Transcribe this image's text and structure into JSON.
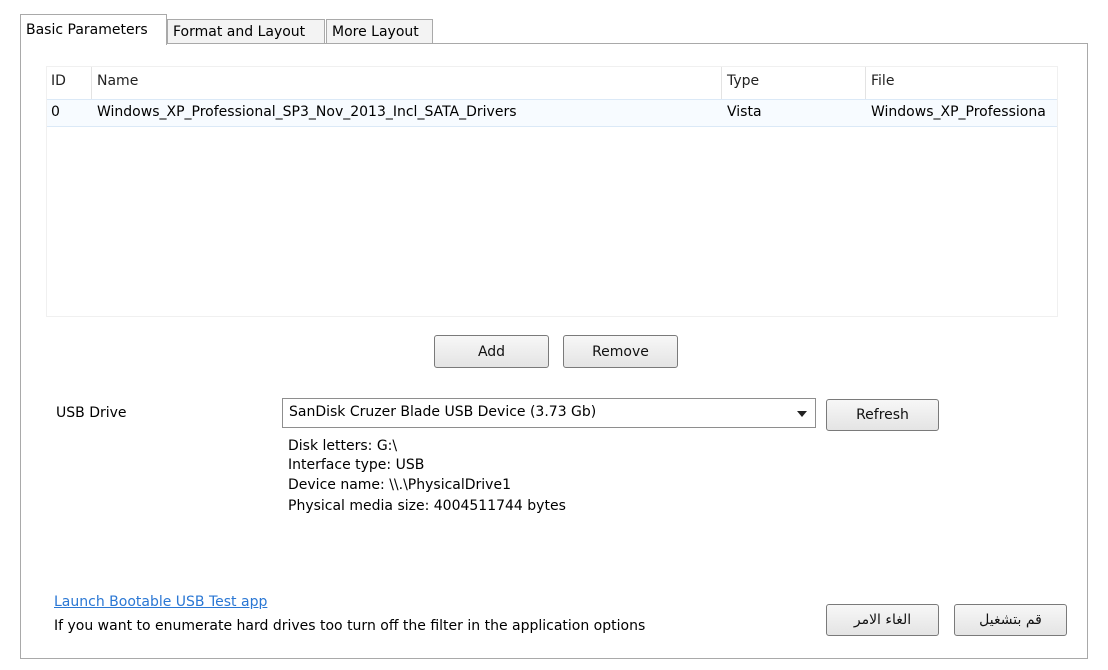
{
  "tabs": [
    {
      "label": "Basic Parameters",
      "active": true
    },
    {
      "label": "Format and Layout",
      "active": false
    },
    {
      "label": "More Layout",
      "active": false
    }
  ],
  "list": {
    "columns": [
      "ID",
      "Name",
      "Type",
      "File"
    ],
    "rows": [
      {
        "id": "0",
        "name": "Windows_XP_Professional_SP3_Nov_2013_Incl_SATA_Drivers",
        "type": "Vista",
        "file": "Windows_XP_Professiona"
      }
    ]
  },
  "buttons": {
    "add": "Add",
    "remove": "Remove",
    "refresh": "Refresh",
    "cancel": "الغاء الامر",
    "run": "قم بتشغيل"
  },
  "usb": {
    "label": "USB Drive",
    "selected": "SanDisk Cruzer Blade USB Device (3.73 Gb)",
    "info": [
      "Disk letters: G:\\",
      "Interface type: USB",
      "Device name: \\\\.\\PhysicalDrive1",
      "Physical media size: 4004511744 bytes"
    ]
  },
  "footer": {
    "link": "Launch Bootable USB Test app",
    "note": "If you want to enumerate hard drives too turn off the filter in the application options"
  }
}
